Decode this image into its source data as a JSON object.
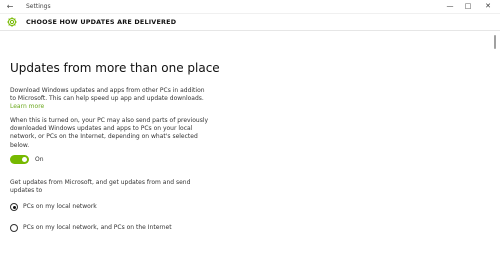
{
  "window": {
    "app_title": "Settings",
    "back_icon": "back-arrow-icon",
    "minimize_icon": "minimize-icon",
    "maximize_icon": "maximize-icon",
    "close_icon": "close-icon"
  },
  "header": {
    "title": "CHOOSE HOW UPDATES ARE DELIVERED",
    "icon": "gear-icon",
    "accent_color": "#76b900"
  },
  "main": {
    "section_title": "Updates from more than one place",
    "description": "Download Windows updates and apps from other PCs in addition to Microsoft. This can help speed up app and update downloads.",
    "learn_more_label": "Learn more",
    "explanation": "When this is turned on, your PC may also send parts of previously downloaded Windows updates and apps to PCs on your local network, or PCs on the Internet, depending on what's selected below.",
    "toggle": {
      "state": "On",
      "on": true
    },
    "choice_prompt": "Get updates from Microsoft, and get updates from and send updates to",
    "options": [
      {
        "label": "PCs on my local network",
        "selected": true
      },
      {
        "label": "PCs on my local network, and PCs on the Internet",
        "selected": false
      }
    ]
  }
}
